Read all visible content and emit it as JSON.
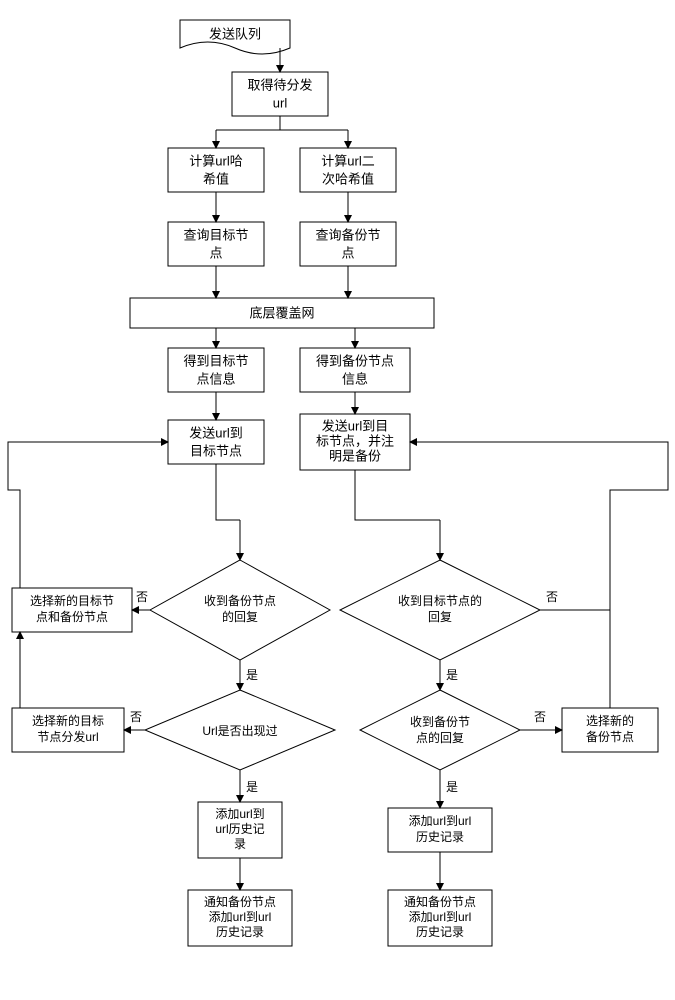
{
  "chart_data": {
    "type": "flowchart",
    "title": "",
    "nodes": [
      {
        "id": "queue",
        "label": "发送队列",
        "shape": "document"
      },
      {
        "id": "get",
        "label": "取得待分发\nurl",
        "shape": "rect"
      },
      {
        "id": "hash1",
        "label": "计算url哈\n希值",
        "shape": "rect"
      },
      {
        "id": "hash2",
        "label": "计算url二\n次哈希值",
        "shape": "rect"
      },
      {
        "id": "find_target",
        "label": "查询目标节\n点",
        "shape": "rect"
      },
      {
        "id": "find_backup",
        "label": "查询备份节\n点",
        "shape": "rect"
      },
      {
        "id": "overlay",
        "label": "底层覆盖网",
        "shape": "rect-wide"
      },
      {
        "id": "got_target",
        "label": "得到目标节\n点信息",
        "shape": "rect"
      },
      {
        "id": "got_backup",
        "label": "得到备份节点\n信息",
        "shape": "rect"
      },
      {
        "id": "send_target",
        "label": "发送url到\n目标节点",
        "shape": "rect"
      },
      {
        "id": "send_backup",
        "label": "发送url到目\n标节点，并注\n明是备份",
        "shape": "rect"
      },
      {
        "id": "reply_backup",
        "label": "收到备份节点\n的回复",
        "shape": "diamond"
      },
      {
        "id": "reply_target",
        "label": "收到目标节点的\n回复",
        "shape": "diamond"
      },
      {
        "id": "new_both",
        "label": "选择新的目标节\n点和备份节点",
        "shape": "rect"
      },
      {
        "id": "url_seen",
        "label": "Url是否出现过",
        "shape": "diamond"
      },
      {
        "id": "reply_backup2",
        "label": "收到备份节\n点的回复",
        "shape": "diamond"
      },
      {
        "id": "new_target",
        "label": "选择新的目标\n节点分发url",
        "shape": "rect"
      },
      {
        "id": "new_backup",
        "label": "选择新的\n备份节点",
        "shape": "rect"
      },
      {
        "id": "add_hist_l",
        "label": "添加url到\nurl历史记\n录",
        "shape": "rect"
      },
      {
        "id": "add_hist_r",
        "label": "添加url到url\n历史记录",
        "shape": "rect"
      },
      {
        "id": "notify_l",
        "label": "通知备份节点\n添加url到url\n历史记录",
        "shape": "rect"
      },
      {
        "id": "notify_r",
        "label": "通知备份节点\n添加url到url\n历史记录",
        "shape": "rect"
      }
    ],
    "labels": {
      "yes": "是",
      "no": "否"
    },
    "edges": [
      [
        "queue",
        "get"
      ],
      [
        "get",
        "hash1"
      ],
      [
        "get",
        "hash2"
      ],
      [
        "hash1",
        "find_target"
      ],
      [
        "hash2",
        "find_backup"
      ],
      [
        "find_target",
        "overlay"
      ],
      [
        "find_backup",
        "overlay"
      ],
      [
        "overlay",
        "got_target"
      ],
      [
        "overlay",
        "got_backup"
      ],
      [
        "got_target",
        "send_target"
      ],
      [
        "got_backup",
        "send_backup"
      ],
      [
        "send_target",
        "reply_backup"
      ],
      [
        "send_backup",
        "reply_target"
      ],
      [
        "reply_backup",
        "url_seen",
        "是"
      ],
      [
        "reply_backup",
        "new_both",
        "否"
      ],
      [
        "reply_target",
        "reply_backup2",
        "是"
      ],
      [
        "reply_target",
        "new_backup",
        "否"
      ],
      [
        "url_seen",
        "add_hist_l",
        "是"
      ],
      [
        "url_seen",
        "new_target",
        "否"
      ],
      [
        "reply_backup2",
        "add_hist_r",
        "是"
      ],
      [
        "reply_backup2",
        "new_backup",
        "否"
      ],
      [
        "add_hist_l",
        "notify_l"
      ],
      [
        "add_hist_r",
        "notify_r"
      ],
      [
        "new_both",
        "send_target"
      ],
      [
        "new_target",
        "send_target"
      ],
      [
        "new_backup",
        "send_backup"
      ]
    ]
  },
  "n": {
    "queue": {
      "l1": "发送队列"
    },
    "get": {
      "l1": "取得待分发",
      "l2": "url"
    },
    "hash1": {
      "l1": "计算url哈",
      "l2": "希值"
    },
    "hash2": {
      "l1": "计算url二",
      "l2": "次哈希值"
    },
    "find_target": {
      "l1": "查询目标节",
      "l2": "点"
    },
    "find_backup": {
      "l1": "查询备份节",
      "l2": "点"
    },
    "overlay": {
      "l1": "底层覆盖网"
    },
    "got_target": {
      "l1": "得到目标节",
      "l2": "点信息"
    },
    "got_backup": {
      "l1": "得到备份节点",
      "l2": "信息"
    },
    "send_target": {
      "l1": "发送url到",
      "l2": "目标节点"
    },
    "send_backup": {
      "l1": "发送url到目",
      "l2": "标节点，并注",
      "l3": "明是备份"
    },
    "reply_backup": {
      "l1": "收到备份节点",
      "l2": "的回复"
    },
    "reply_target": {
      "l1": "收到目标节点的",
      "l2": "回复"
    },
    "new_both": {
      "l1": "选择新的目标节",
      "l2": "点和备份节点"
    },
    "url_seen": {
      "l1": "Url是否出现过"
    },
    "reply_backup2": {
      "l1": "收到备份节",
      "l2": "点的回复"
    },
    "new_target": {
      "l1": "选择新的目标",
      "l2": "节点分发url"
    },
    "new_backup": {
      "l1": "选择新的",
      "l2": "备份节点"
    },
    "add_hist_l": {
      "l1": "添加url到",
      "l2": "url历史记",
      "l3": "录"
    },
    "add_hist_r": {
      "l1": "添加url到url",
      "l2": "历史记录"
    },
    "notify_l": {
      "l1": "通知备份节点",
      "l2": "添加url到url",
      "l3": "历史记录"
    },
    "notify_r": {
      "l1": "通知备份节点",
      "l2": "添加url到url",
      "l3": "历史记录"
    }
  },
  "lbl": {
    "yes": "是",
    "no": "否"
  }
}
